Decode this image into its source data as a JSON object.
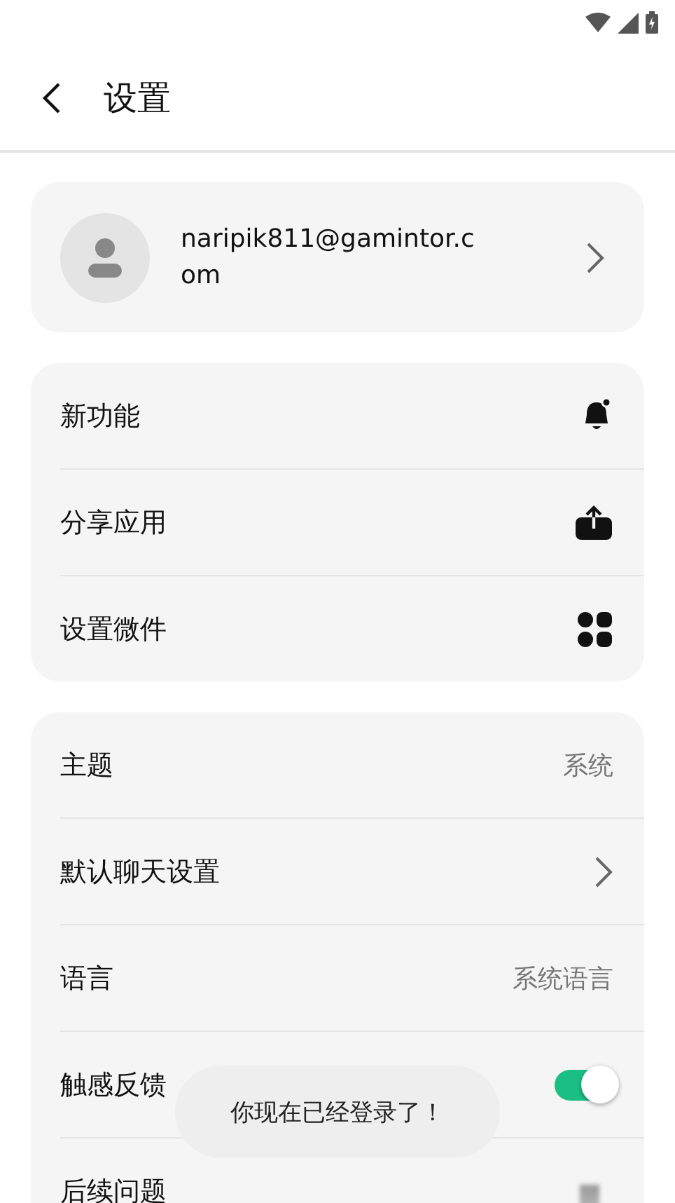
{
  "header": {
    "title": "设置"
  },
  "account": {
    "email": "naripik811@gamintor.com"
  },
  "groups": [
    {
      "items": [
        {
          "label": "新功能",
          "kind": "bell"
        },
        {
          "label": "分享应用",
          "kind": "share"
        },
        {
          "label": "设置微件",
          "kind": "grid"
        }
      ]
    },
    {
      "items": [
        {
          "label": "主题",
          "kind": "value",
          "value": "系统"
        },
        {
          "label": "默认聊天设置",
          "kind": "chevron"
        },
        {
          "label": "语言",
          "kind": "value",
          "value": "系统语言"
        },
        {
          "label": "触感反馈",
          "kind": "toggle",
          "on": true
        },
        {
          "label": "后续问题",
          "kind": "blurred"
        }
      ]
    }
  ],
  "toast": {
    "text": "你现在已经登录了！"
  }
}
